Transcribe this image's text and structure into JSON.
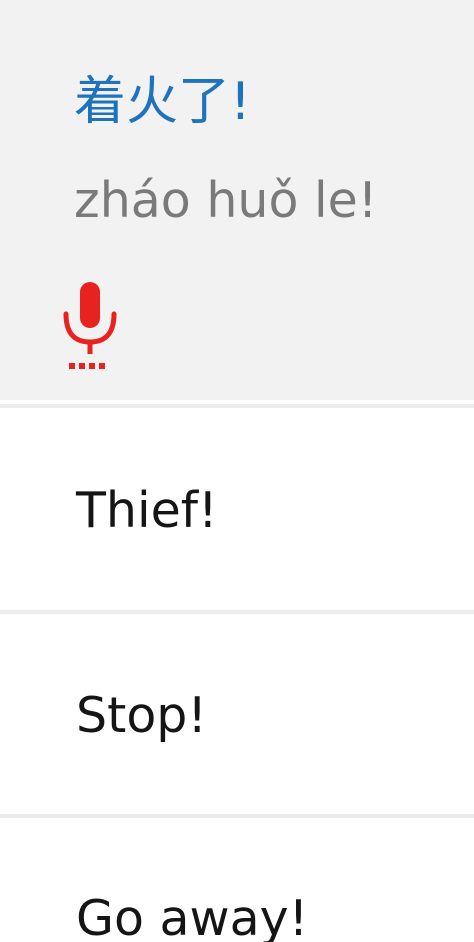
{
  "expanded_phrase": {
    "chinese": "着火了!",
    "pinyin": "zháo huǒ le!",
    "chinese_color": "#1e73be",
    "pinyin_color": "#7a7a7a",
    "background": "#f2f2f2",
    "record_icon": "microphone-icon",
    "record_icon_color": "#e8231f"
  },
  "phrases": [
    {
      "label": "Thief!"
    },
    {
      "label": "Stop!"
    },
    {
      "label": "Go away!"
    }
  ]
}
